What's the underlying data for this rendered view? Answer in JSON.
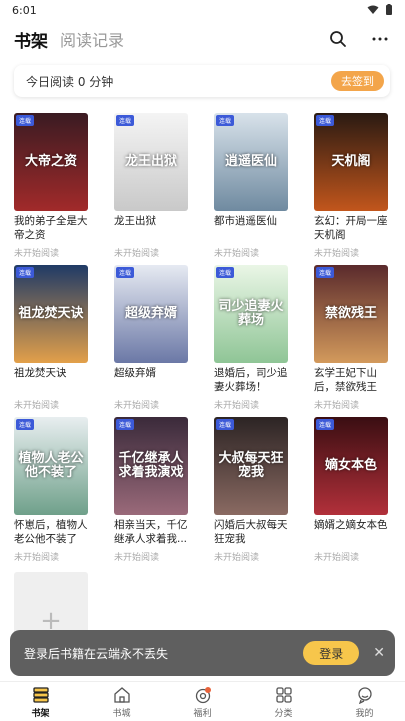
{
  "status_bar": {
    "time": "6:01"
  },
  "header": {
    "tab_bookshelf": "书架",
    "tab_history": "阅读记录"
  },
  "reading": {
    "text": "今日阅读 0 分钟",
    "signin_label": "去签到"
  },
  "books": [
    {
      "title": "我的弟子全是大帝之资",
      "cover_text": "大帝之资",
      "status": "未开始阅读",
      "tag": "连载",
      "color_top": "#3a1b22",
      "color_bottom": "#a22a2a"
    },
    {
      "title": "龙王出狱",
      "cover_text": "龙王出狱",
      "status": "未开始阅读",
      "tag": "连载",
      "color_top": "#f4f4f4",
      "color_bottom": "#c9c9c9"
    },
    {
      "title": "都市逍遥医仙",
      "cover_text": "逍遥医仙",
      "status": "未开始阅读",
      "tag": "连载",
      "color_top": "#d8e2ea",
      "color_bottom": "#6f8aa0"
    },
    {
      "title": "玄幻：开局一座天机阁",
      "cover_text": "天机阁",
      "status": "未开始阅读",
      "tag": "连载",
      "color_top": "#2a1a12",
      "color_bottom": "#c2561c"
    },
    {
      "title": "祖龙焚天诀",
      "cover_text": "祖龙焚天诀",
      "status": "未开始阅读",
      "tag": "连载",
      "color_top": "#1f3a66",
      "color_bottom": "#e3a04a"
    },
    {
      "title": "超级弃婿",
      "cover_text": "超级弃婿",
      "status": "未开始阅读",
      "tag": "连载",
      "color_top": "#e6eaf2",
      "color_bottom": "#6b78a6"
    },
    {
      "title": "退婚后，司少追妻火葬场！",
      "cover_text": "司少追妻火葬场",
      "status": "未开始阅读",
      "tag": "连载",
      "color_top": "#eaf6e6",
      "color_bottom": "#8fc596"
    },
    {
      "title": "玄学王妃下山后，禁欲残王宠...",
      "cover_text": "禁欲残王",
      "status": "未开始阅读",
      "tag": "连载",
      "color_top": "#5a2a2c",
      "color_bottom": "#d39a5c"
    },
    {
      "title": "怀崽后，植物人老公他不装了",
      "cover_text": "植物人老公他不装了",
      "status": "未开始阅读",
      "tag": "连载",
      "color_top": "#e8eef0",
      "color_bottom": "#6fa08a"
    },
    {
      "title": "相亲当天，千亿继承人求着我...",
      "cover_text": "千亿继承人求着我演戏",
      "status": "未开始阅读",
      "tag": "连载",
      "color_top": "#3a2a3a",
      "color_bottom": "#9a6a7a"
    },
    {
      "title": "闪婚后大叔每天狂宠我",
      "cover_text": "大叔每天狂宠我",
      "status": "未开始阅读",
      "tag": "连载",
      "color_top": "#2c2424",
      "color_bottom": "#8a6a62"
    },
    {
      "title": "嫡婿之嫡女本色",
      "cover_text": "嫡女本色",
      "status": "未开始阅读",
      "tag": "连载",
      "color_top": "#3a0e12",
      "color_bottom": "#b2303a"
    }
  ],
  "add_tile": {
    "symbol": "+"
  },
  "login_banner": {
    "text": "登录后书籍在云端永不丢失",
    "button": "登录",
    "close": "✕"
  },
  "bottom_nav": [
    {
      "label": "书架",
      "icon": "bookshelf-icon"
    },
    {
      "label": "书城",
      "icon": "store-icon"
    },
    {
      "label": "福利",
      "icon": "gift-icon"
    },
    {
      "label": "分类",
      "icon": "category-icon"
    },
    {
      "label": "我的",
      "icon": "profile-icon"
    }
  ]
}
